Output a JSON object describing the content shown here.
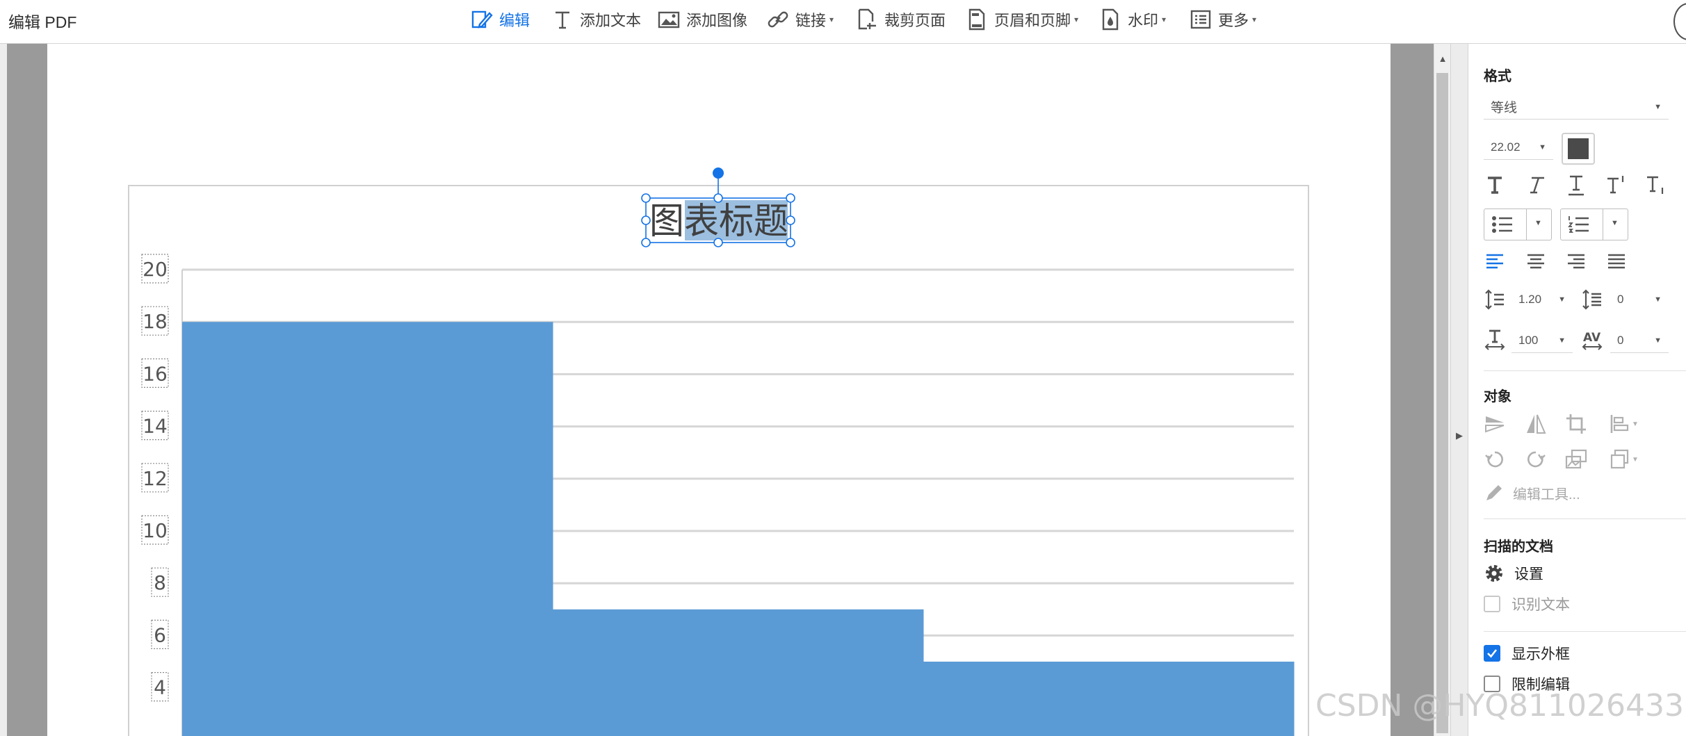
{
  "app": {
    "title": "编辑 PDF"
  },
  "toolbar": {
    "items": [
      {
        "label": "编辑",
        "icon": "edit-icon",
        "active": true,
        "has_menu": false
      },
      {
        "label": "添加文本",
        "icon": "text-icon",
        "active": false,
        "has_menu": false
      },
      {
        "label": "添加图像",
        "icon": "image-icon",
        "active": false,
        "has_menu": false
      },
      {
        "label": "链接",
        "icon": "link-icon",
        "active": false,
        "has_menu": true
      },
      {
        "label": "裁剪页面",
        "icon": "crop-page-icon",
        "active": false,
        "has_menu": false
      },
      {
        "label": "页眉和页脚",
        "icon": "header-footer-icon",
        "active": false,
        "has_menu": true
      },
      {
        "label": "水印",
        "icon": "watermark-icon",
        "active": false,
        "has_menu": true
      },
      {
        "label": "更多",
        "icon": "more-icon",
        "active": false,
        "has_menu": true
      }
    ],
    "accent_color": "#1473e6"
  },
  "chart_data": {
    "type": "bar",
    "title": "图表标题",
    "title_selected_text": "表标题",
    "categories": [
      "",
      "",
      ""
    ],
    "values": [
      18,
      7,
      5
    ],
    "ylim": [
      0,
      20
    ],
    "y_ticks": [
      "20",
      "18",
      "16",
      "14",
      "12",
      "10",
      "8",
      "6",
      "4"
    ],
    "grid": true,
    "bar_color": "#5b9bd5"
  },
  "panel": {
    "format_title": "格式",
    "font_name": "等线",
    "font_size": "22.02",
    "font_color": "#4a4a4a",
    "line_spacing": "1.20",
    "paragraph_spacing": "0",
    "horizontal_scale": "100",
    "char_spacing": "0",
    "object_title": "对象",
    "edit_tool_label": "编辑工具...",
    "scanned_title": "扫描的文档",
    "settings_label": "设置",
    "recognize_label": "识别文本",
    "show_bbox_label": "显示外框",
    "show_bbox_checked": true,
    "restrict_label": "限制编辑",
    "restrict_checked": false
  },
  "watermark": "CSDN @HYQ811026433"
}
